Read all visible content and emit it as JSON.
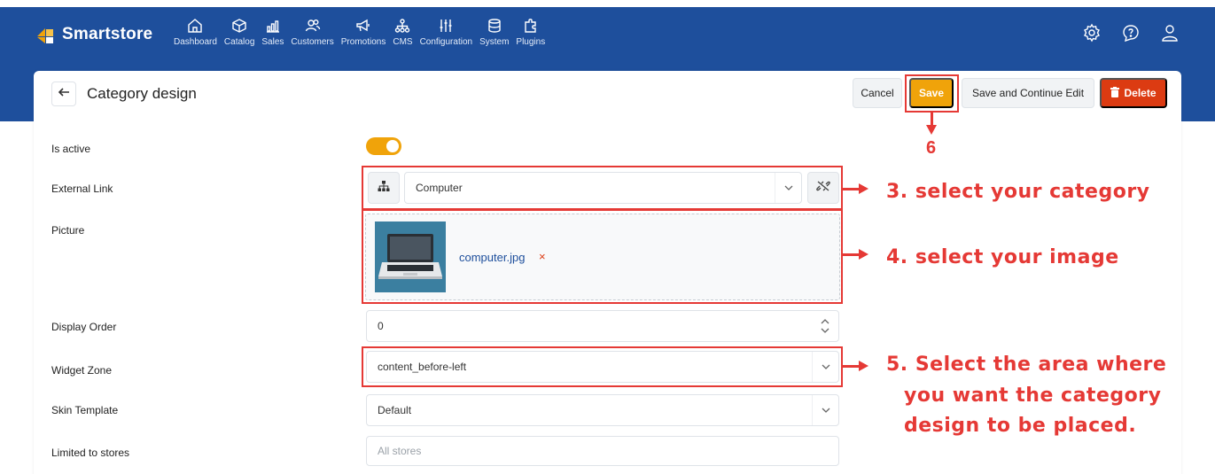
{
  "app": {
    "name": "Smartstore",
    "brand_color": "#1e4f9c",
    "accent": "#f0a30a",
    "danger": "#dc3b12",
    "annotation_color": "#e53935"
  },
  "nav": [
    {
      "label": "Dashboard",
      "icon": "home-icon"
    },
    {
      "label": "Catalog",
      "icon": "cube-icon"
    },
    {
      "label": "Sales",
      "icon": "chart-icon"
    },
    {
      "label": "Customers",
      "icon": "users-icon"
    },
    {
      "label": "Promotions",
      "icon": "megaphone-icon"
    },
    {
      "label": "CMS",
      "icon": "sitemap-icon"
    },
    {
      "label": "Configuration",
      "icon": "sliders-icon"
    },
    {
      "label": "System",
      "icon": "database-icon"
    },
    {
      "label": "Plugins",
      "icon": "puzzle-icon"
    }
  ],
  "page": {
    "title": "Category design"
  },
  "toolbar": {
    "cancel": "Cancel",
    "save": "Save",
    "save_continue": "Save and Continue Edit",
    "delete": "Delete"
  },
  "form": {
    "is_active": {
      "label": "Is active",
      "value": true
    },
    "external_link": {
      "label": "External Link",
      "value": "Computer"
    },
    "picture": {
      "label": "Picture",
      "file": "computer.jpg",
      "remove": "×"
    },
    "display_order": {
      "label": "Display Order",
      "value": "0"
    },
    "widget_zone": {
      "label": "Widget Zone",
      "value": "content_before-left"
    },
    "skin_template": {
      "label": "Skin Template",
      "value": "Default"
    },
    "limited_to_stores": {
      "label": "Limited to stores",
      "placeholder": "All stores"
    }
  },
  "annotations": {
    "step6": "6",
    "step3": "3. select your category",
    "step4": "4. select your image",
    "step5_line1": "5. Select the area where",
    "step5_line2": "you want the category",
    "step5_line3": "design to be placed."
  }
}
